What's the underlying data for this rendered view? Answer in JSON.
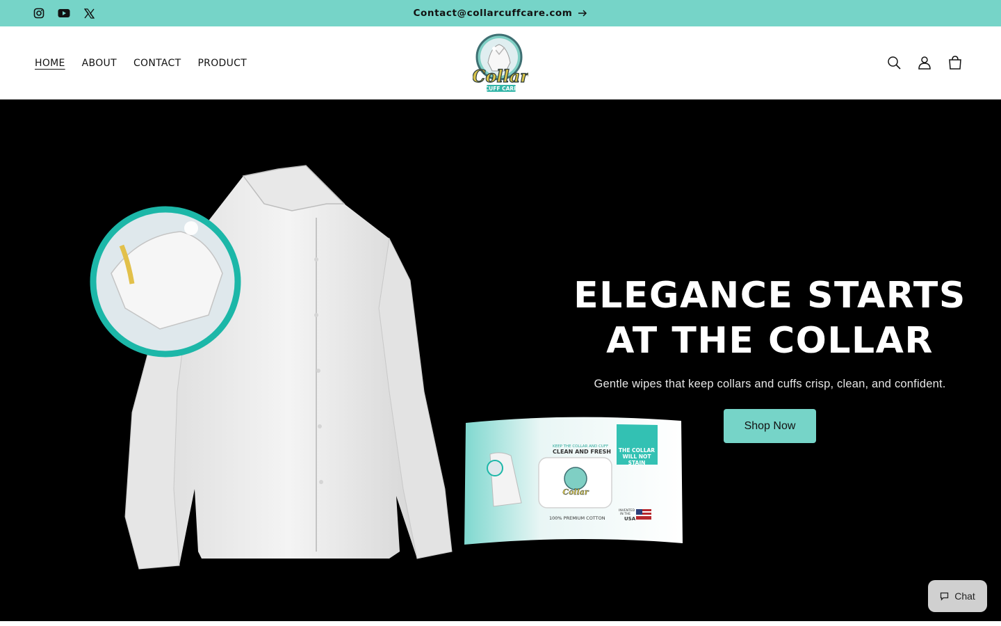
{
  "announcement": {
    "text": "Contact@collarcuffcare.com",
    "arrow_icon": "arrow-right-icon",
    "background": "#76d4c8"
  },
  "social": [
    {
      "name": "instagram-icon"
    },
    {
      "name": "youtube-icon"
    },
    {
      "name": "x-twitter-icon"
    }
  ],
  "nav": {
    "items": [
      {
        "label": "HOME",
        "active": true
      },
      {
        "label": "ABOUT"
      },
      {
        "label": "CONTACT"
      },
      {
        "label": "PRODUCT"
      }
    ]
  },
  "logo": {
    "text_main": "Collar",
    "text_sub": "CUFF CARE"
  },
  "header_icons": [
    "search-icon",
    "account-icon",
    "cart-icon"
  ],
  "hero": {
    "title_line1": "ELEGANCE STARTS",
    "title_line2": "AT THE COLLAR",
    "subtitle": "Gentle wipes that keep collars and cuffs crisp, clean, and confident.",
    "cta_label": "Shop Now",
    "pack": {
      "tagline_small": "KEEP THE COLLAR AND CUFF",
      "tagline": "CLEAN AND FRESH",
      "badge_line1": "THE COLLAR",
      "badge_line2": "WILL NOT",
      "badge_line3": "STAIN",
      "cotton": "100% PREMIUM COTTON",
      "invented_line1": "INVENTED",
      "invented_line2": "IN THE",
      "invented_line3": "USA"
    }
  },
  "chat": {
    "label": "Chat"
  }
}
